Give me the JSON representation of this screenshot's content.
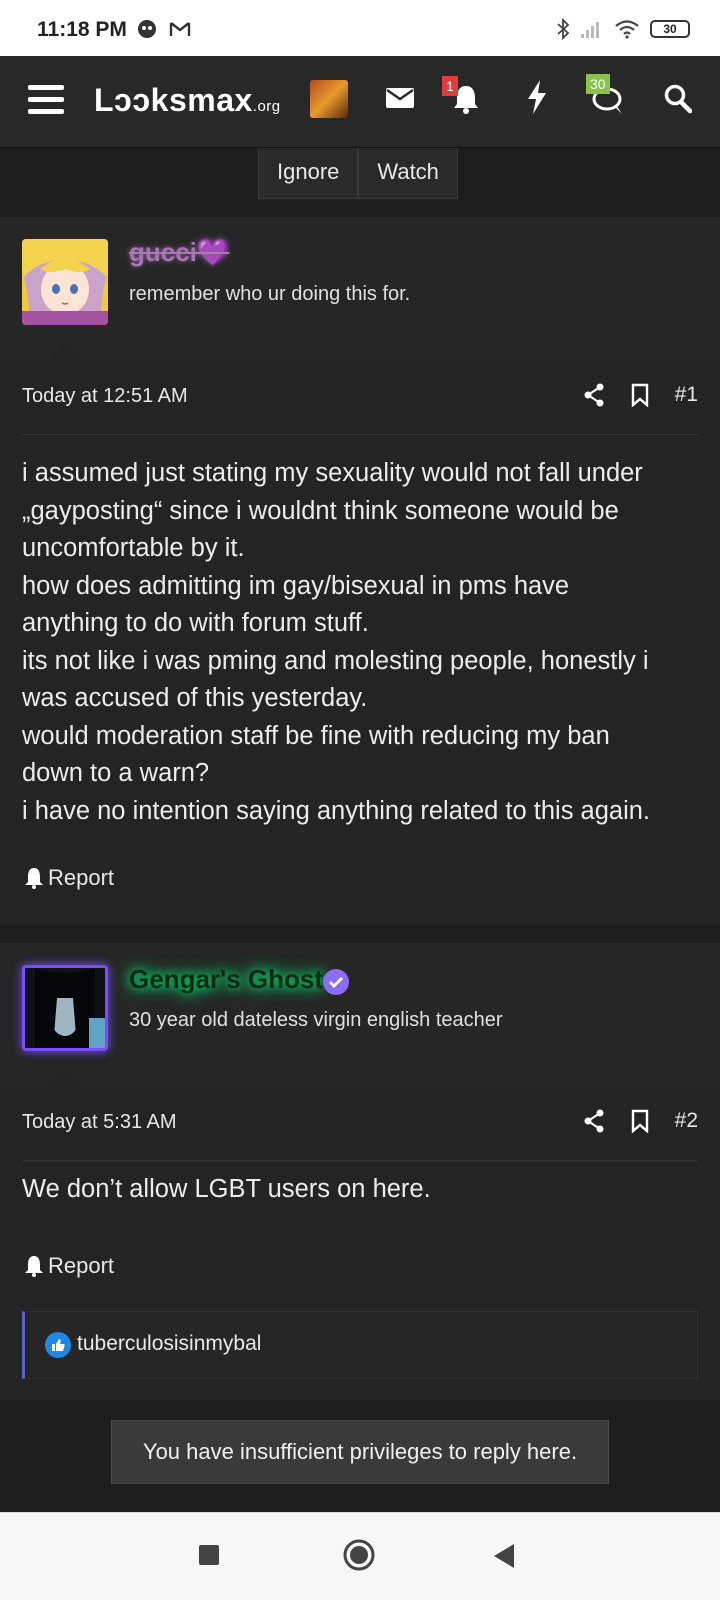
{
  "status_bar": {
    "time": "11:18 PM",
    "battery": "30"
  },
  "header": {
    "logo_main": "Lɔɔksmax",
    "logo_suffix": ".org",
    "notifications_badge": "1",
    "conversations_badge": "30"
  },
  "thread_actions": {
    "ignore": "Ignore",
    "watch": "Watch"
  },
  "posts": [
    {
      "username": "gucci💜",
      "user_title": "remember who ur doing this for.",
      "timestamp": "Today at 12:51 AM",
      "number": "#1",
      "lines": [
        "i assumed just stating my sexuality would not fall under",
        "„gayposting“ since i wouldnt think someone would be",
        "uncomfortable by it.",
        "how does admitting im gay/bisexual in pms have",
        "anything to do with forum stuff.",
        "its not like i was pming and molesting people, honestly i",
        "was accused of this yesterday.",
        "would moderation staff be fine with reducing my ban",
        "down to a warn?",
        "i have no intention saying anything related to this again."
      ],
      "report": "Report"
    },
    {
      "username": "Gengar's Ghost",
      "user_title": "30 year old dateless virgin english teacher",
      "timestamp": "Today at 5:31 AM",
      "number": "#2",
      "lines": [
        "We don’t allow LGBT users on here."
      ],
      "report": "Report",
      "reaction_user": "tuberculosisinmybal"
    }
  ],
  "reply_notice": "You have insufficient privileges to reply here.",
  "colors": {
    "accent_purple": "#7c4dff",
    "username_glow": "#00e676",
    "reaction_border": "#5d62c9"
  }
}
